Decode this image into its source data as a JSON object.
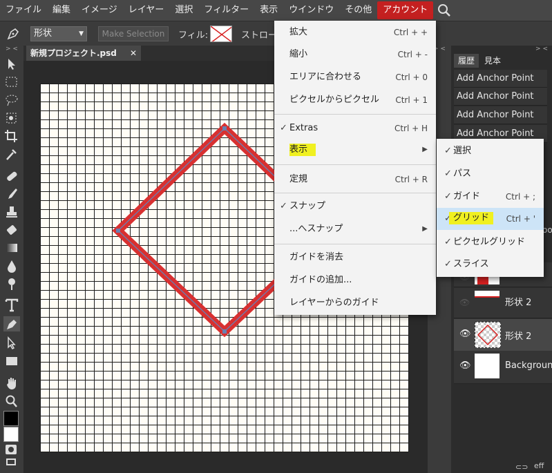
{
  "menubar": {
    "items": [
      "ファイル",
      "編集",
      "イメージ",
      "レイヤー",
      "選択",
      "フィルター",
      "表示",
      "ウインドウ",
      "その他",
      "アカウント"
    ]
  },
  "options": {
    "shape_select": "形状",
    "make_selection": "Make Selection",
    "fill_label": "フィル:",
    "stroke_label": "ストロー"
  },
  "document": {
    "tab_title": "新規プロジェクト.psd",
    "close_glyph": "✕"
  },
  "view_menu": {
    "items": [
      {
        "label": "拡大",
        "shortcut": "Ctrl + +"
      },
      {
        "label": "縮小",
        "shortcut": "Ctrl + -"
      },
      {
        "label": "エリアに合わせる",
        "shortcut": "Ctrl + 0"
      },
      {
        "label": "ピクセルからピクセル",
        "shortcut": "Ctrl + 1"
      },
      {
        "label": "Extras",
        "shortcut": "Ctrl + H",
        "checked": "✓"
      },
      {
        "label": "表示",
        "arrow": "▶"
      },
      {
        "label": "定規",
        "shortcut": "Ctrl + R"
      },
      {
        "label": "スナップ",
        "checked": "✓"
      },
      {
        "label": "...へスナップ",
        "arrow": "▶"
      },
      {
        "label": "ガイドを消去"
      },
      {
        "label": "ガイドの追加..."
      },
      {
        "label": "レイヤーからのガイド"
      }
    ]
  },
  "show_submenu": {
    "items": [
      {
        "label": "選択",
        "checked": "✓"
      },
      {
        "label": "パス",
        "checked": "✓"
      },
      {
        "label": "ガイド",
        "checked": "✓",
        "shortcut": "Ctrl + ;"
      },
      {
        "label": "グリッド",
        "checked": "✓",
        "shortcut": "Ctrl + '"
      },
      {
        "label": "ピクセルグリッド",
        "checked": "✓"
      },
      {
        "label": "スライス",
        "checked": "✓"
      }
    ]
  },
  "right_panel": {
    "tab_history": "履歴",
    "tab_swatches": "見本",
    "history": [
      "Add Anchor Point",
      "Add Anchor Point",
      "Add Anchor Point",
      "Add Anchor Point"
    ],
    "layers": [
      "形状 2",
      "形状 2",
      "Background"
    ],
    "partial_label": "oo",
    "bottom_text": "eff"
  },
  "colors": {
    "accent": "#c42020",
    "highlight": "#f0f020",
    "selection": "#cde4f7"
  }
}
